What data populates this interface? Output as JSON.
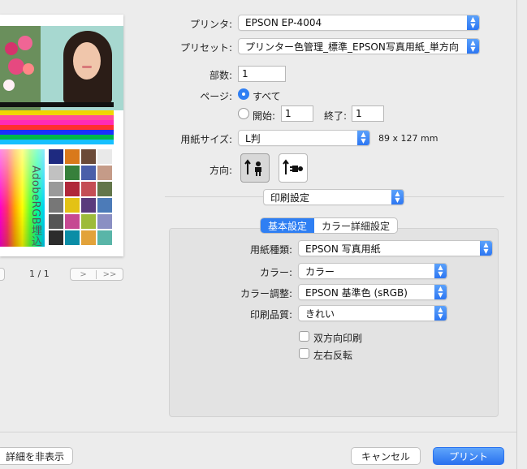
{
  "colors": {
    "accent": "#2f7ff3"
  },
  "preview": {
    "page_count": "1 / 1",
    "watermark_text": "AdobeRGB埋込",
    "prev_icon": "chevron-right-icon",
    "last_icon": "double-chevron-right-icon"
  },
  "printer": {
    "label": "プリンタ:",
    "value": "EPSON EP-4004"
  },
  "preset": {
    "label": "プリセット:",
    "value": "プリンター色管理_標準_EPSON写真用紙_単方向"
  },
  "copies": {
    "label": "部数:",
    "value": "1"
  },
  "pages": {
    "label": "ページ:",
    "all_label": "すべて",
    "from_label": "開始:",
    "from_value": "1",
    "to_label": "終了:",
    "to_value": "1"
  },
  "paper_size": {
    "label": "用紙サイズ:",
    "value": "L判",
    "dimensions": "89 x 127 mm"
  },
  "orientation": {
    "label": "方向:"
  },
  "section_popup": {
    "value": "印刷設定"
  },
  "tabs": [
    {
      "label": "基本設定"
    },
    {
      "label": "カラー詳細設定"
    }
  ],
  "settings": {
    "media_type": {
      "label": "用紙種類:",
      "value": "EPSON 写真用紙"
    },
    "color": {
      "label": "カラー:",
      "value": "カラー"
    },
    "color_adjust": {
      "label": "カラー調整:",
      "value": "EPSON 基準色 (sRGB)"
    },
    "quality": {
      "label": "印刷品質:",
      "value": "きれい"
    },
    "bidirectional": {
      "label": "双方向印刷",
      "checked": false
    },
    "mirror": {
      "label": "左右反転",
      "checked": false
    }
  },
  "footer": {
    "hide_details": "詳細を非表示",
    "cancel": "キャンセル",
    "print": "プリント"
  }
}
